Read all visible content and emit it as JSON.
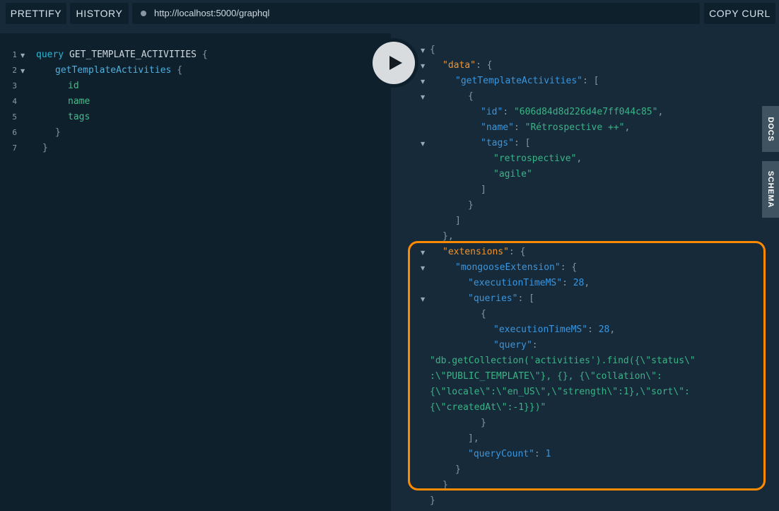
{
  "toolbar": {
    "prettify_label": "PRETTIFY",
    "history_label": "HISTORY",
    "endpoint_url": "http://localhost:5000/graphql",
    "copy_curl_label": "COPY CURL"
  },
  "sidebar_tabs": {
    "docs_label": "DOCS",
    "schema_label": "SCHEMA"
  },
  "editor": {
    "line_numbers": [
      "1",
      "2",
      "3",
      "4",
      "5",
      "6",
      "7"
    ],
    "query_keyword": "query",
    "operation_name": "GET_TEMPLATE_ACTIVITIES",
    "field_root": "getTemplateActivities",
    "selections": [
      "id",
      "name",
      "tags"
    ]
  },
  "result": {
    "data_key": "\"data\"",
    "root_key": "\"getTemplateActivities\"",
    "item": {
      "id_key": "\"id\"",
      "id_value": "\"606d84d8d226d4e7ff044c85\"",
      "name_key": "\"name\"",
      "name_value": "\"Rétrospective ++\"",
      "tags_key": "\"tags\"",
      "tags": [
        "\"retrospective\"",
        "\"agile\""
      ]
    },
    "extensions_key": "\"extensions\"",
    "mongoose_key": "\"mongooseExtension\"",
    "execution_key": "\"executionTimeMS\"",
    "execution_value": "28",
    "queries_key": "\"queries\"",
    "query_execution_key": "\"executionTimeMS\"",
    "query_execution_value": "28",
    "query_key": "\"query\"",
    "query_lines": [
      "\"db.getCollection('activities').find({\\\"status\\\"",
      ":\\\"PUBLIC_TEMPLATE\\\"}, {}, {\\\"collation\\\":",
      "{\\\"locale\\\":\\\"en_US\\\",\\\"strength\\\":1},\\\"sort\\\":",
      "{\\\"createdAt\\\":-1}})\""
    ],
    "query_count_key": "\"queryCount\"",
    "query_count_value": "1"
  },
  "colors": {
    "highlight_border": "#ff8a00",
    "key_orange": "#f0952d",
    "key_blue": "#3a96de",
    "string_green": "#3ab486"
  }
}
